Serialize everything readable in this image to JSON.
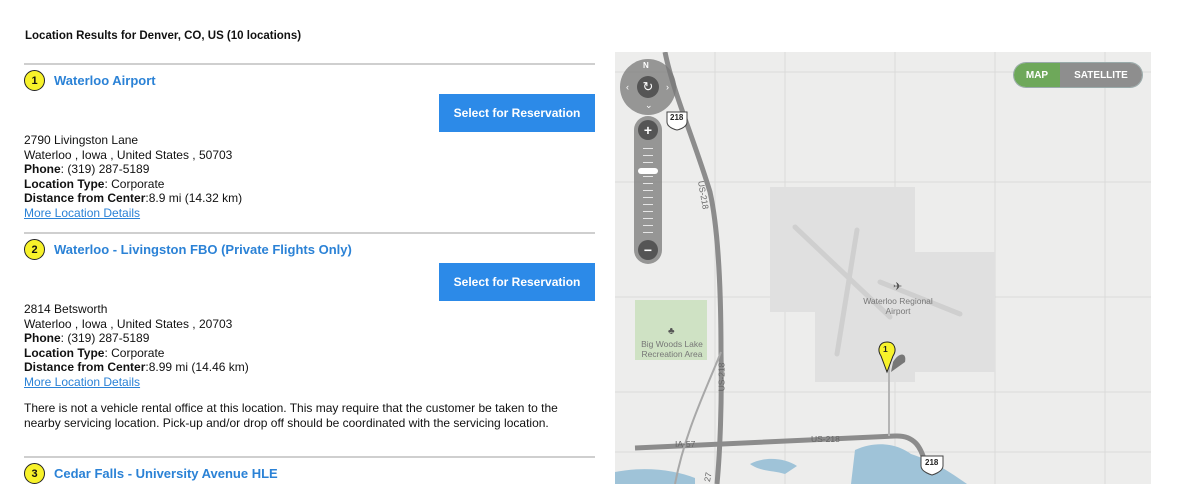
{
  "header": {
    "results_text": "Location Results for Denver, CO, US (10 locations)"
  },
  "locations": [
    {
      "number": "1",
      "name": "Waterloo Airport",
      "select_label": "Select for Reservation",
      "street": "2790 Livingston Lane",
      "city_line": "Waterloo , Iowa , United States , 50703",
      "phone_label": "Phone",
      "phone": ": (319) 287-5189",
      "type_label": "Location Type",
      "type": ": Corporate",
      "distance_label": "Distance from Center",
      "distance": ":8.9 mi (14.32 km)",
      "details_link": "More Location Details"
    },
    {
      "number": "2",
      "name": "Waterloo - Livingston FBO (Private Flights Only)",
      "select_label": "Select for Reservation",
      "street": "2814 Betsworth",
      "city_line": "Waterloo , Iowa , United States , 20703",
      "phone_label": "Phone",
      "phone": ": (319) 287-5189",
      "type_label": "Location Type",
      "type": ": Corporate",
      "distance_label": "Distance from Center",
      "distance": ":8.99 mi (14.46 km)",
      "details_link": "More Location Details",
      "note": "There is not a vehicle rental office at this location. This may require that the customer be taken to the nearby servicing location. Pick-up and/or drop off should be coordinated with the servicing location."
    },
    {
      "number": "3",
      "name": "Cedar Falls - University Avenue HLE"
    }
  ],
  "map": {
    "toggle": {
      "map_label": "MAP",
      "satellite_label": "SATELLITE",
      "active": "MAP"
    },
    "compass_north": "N",
    "zoom_in": "+",
    "zoom_out": "−",
    "labels": {
      "airport": "Waterloo Regional Airport",
      "park": "Big Woods Lake Recreation Area",
      "us218_shield": "218",
      "us218_road": "US-218",
      "ia57": "IA-57",
      "us27": "27"
    },
    "marker_number": "1",
    "colors": {
      "map_toggle": "#6ea85a",
      "satellite_toggle": "#8e8e8e",
      "marker": "#f7f22a",
      "water": "#9fc3d8"
    }
  }
}
